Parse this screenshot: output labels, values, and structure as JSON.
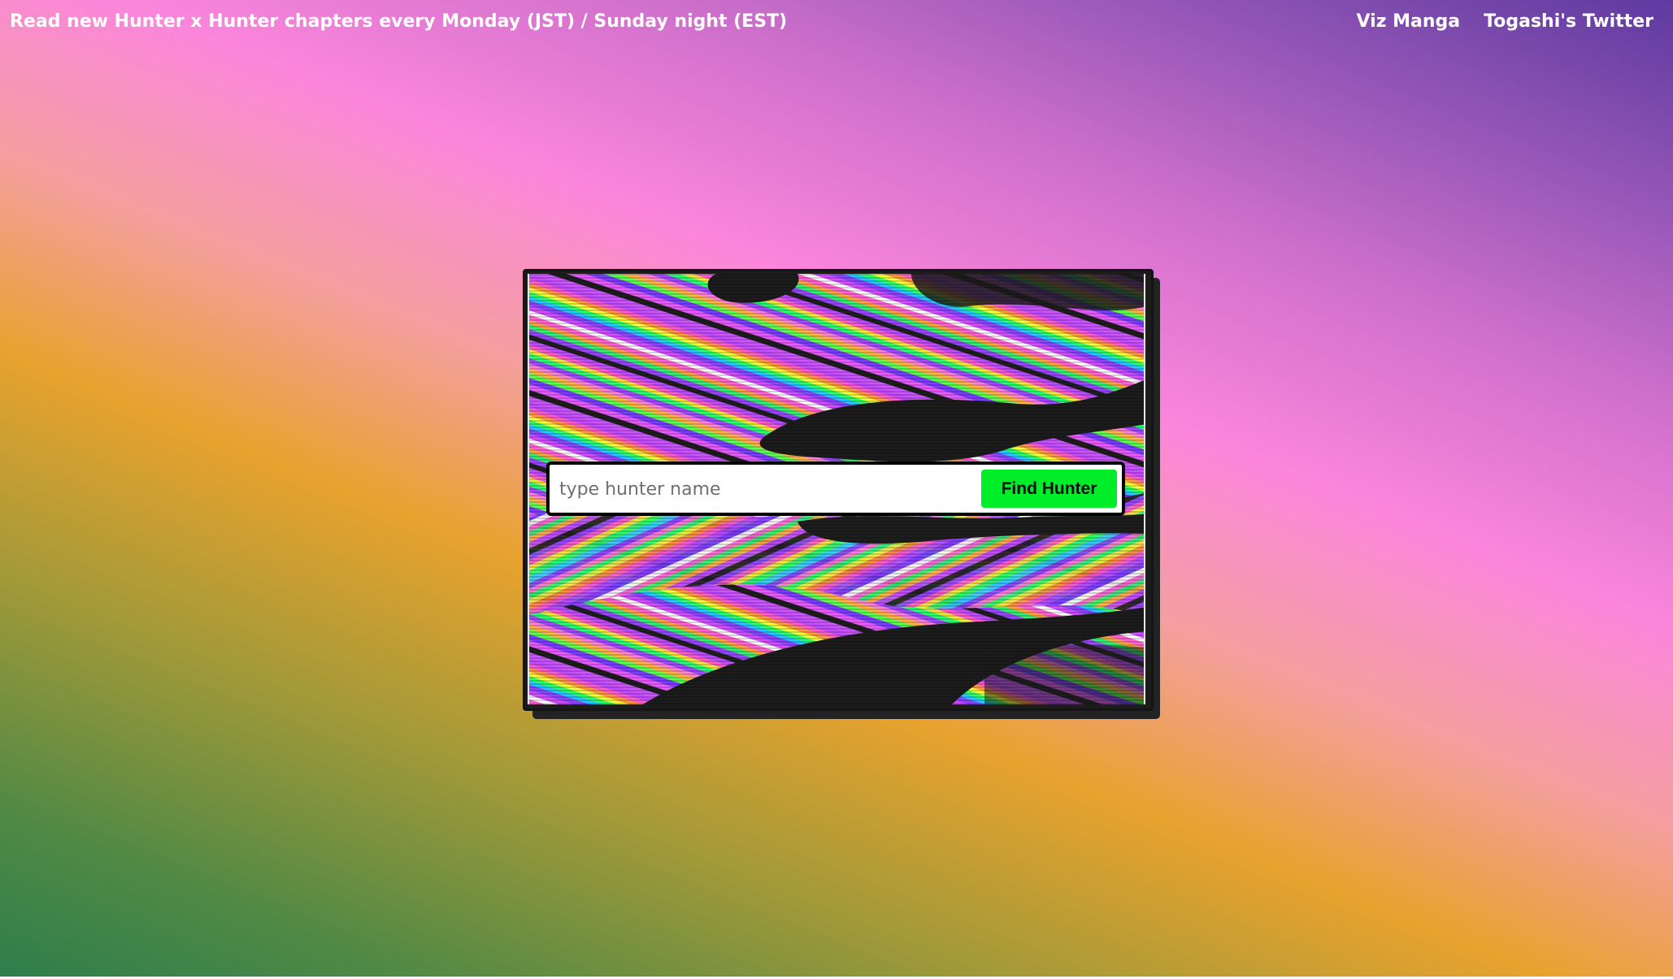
{
  "header": {
    "announcement": "Read new Hunter x Hunter chapters every Monday (JST) / Sunday night (EST)",
    "links": [
      {
        "label": "Viz Manga"
      },
      {
        "label": "Togashi's Twitter"
      }
    ]
  },
  "search": {
    "placeholder": "type hunter name",
    "value": "",
    "button_label": "Find Hunter"
  },
  "colors": {
    "button_green": "#00ee2a",
    "gradient": [
      "#2e7e4c",
      "#e8a22e",
      "#fb86dc",
      "#5e3aa0"
    ]
  }
}
